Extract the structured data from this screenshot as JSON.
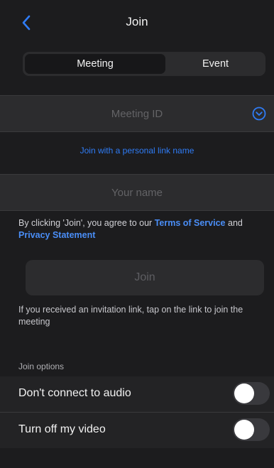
{
  "header": {
    "title": "Join"
  },
  "mode_switch": {
    "options": [
      "Meeting",
      "Event"
    ],
    "selected": "Meeting"
  },
  "meeting_id": {
    "placeholder": "Meeting ID",
    "value": ""
  },
  "personal_link": {
    "label": "Join with a personal link name"
  },
  "name_field": {
    "placeholder": "Your name",
    "value": ""
  },
  "agreement": {
    "prefix": "By clicking 'Join', you agree to our ",
    "terms_label": "Terms of Service",
    "conjunction": " and ",
    "privacy_label": "Privacy Statement"
  },
  "join_button": {
    "label": "Join"
  },
  "invite_hint": "If you received an invitation link, tap on the link to join the meeting",
  "join_options": {
    "header": "Join options",
    "items": [
      {
        "label": "Don't connect to audio",
        "enabled": false
      },
      {
        "label": "Turn off my video",
        "enabled": false
      }
    ]
  },
  "icons": {
    "back": "chevron-left-icon",
    "dropdown": "chevron-down-circle-icon"
  },
  "colors": {
    "accent": "#2f7cf6",
    "background": "#1c1c1e",
    "field": "#2c2c2e"
  }
}
